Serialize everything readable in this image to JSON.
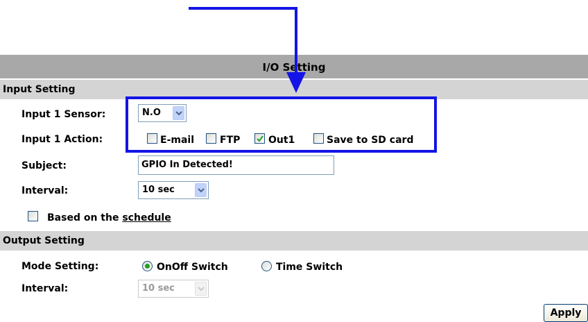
{
  "header": {
    "title": "I/O Setting"
  },
  "input_setting": {
    "section_label": "Input Setting",
    "sensor_label": "Input 1 Sensor:",
    "sensor_value": "N.O",
    "action_label": "Input 1 Action:",
    "actions": [
      {
        "label": "E-mail",
        "checked": false
      },
      {
        "label": "FTP",
        "checked": false
      },
      {
        "label": "Out1",
        "checked": true
      },
      {
        "label": "Save to SD card",
        "checked": false
      }
    ],
    "subject_label": "Subject:",
    "subject_value": "GPIO In Detected!",
    "interval_label": "Interval:",
    "interval_value": "10 sec",
    "schedule_prefix": "Based on the",
    "schedule_link": "schedule",
    "schedule_checked": false
  },
  "output_setting": {
    "section_label": "Output Setting",
    "mode_label": "Mode Setting:",
    "mode_options": [
      {
        "label": "OnOff Switch",
        "selected": true
      },
      {
        "label": "Time Switch",
        "selected": false
      }
    ],
    "interval_label": "Interval:",
    "interval_value": "10 sec",
    "interval_disabled": true
  },
  "footer": {
    "apply_label": "Apply"
  },
  "colors": {
    "annotation": "#1414e6",
    "title_bar": "#a8a8a8",
    "section_bar": "#d4d4d4",
    "check": "#21a121"
  },
  "annotation": {
    "arrow_icon": "arrow-down-icon",
    "frame": "highlight-box"
  }
}
